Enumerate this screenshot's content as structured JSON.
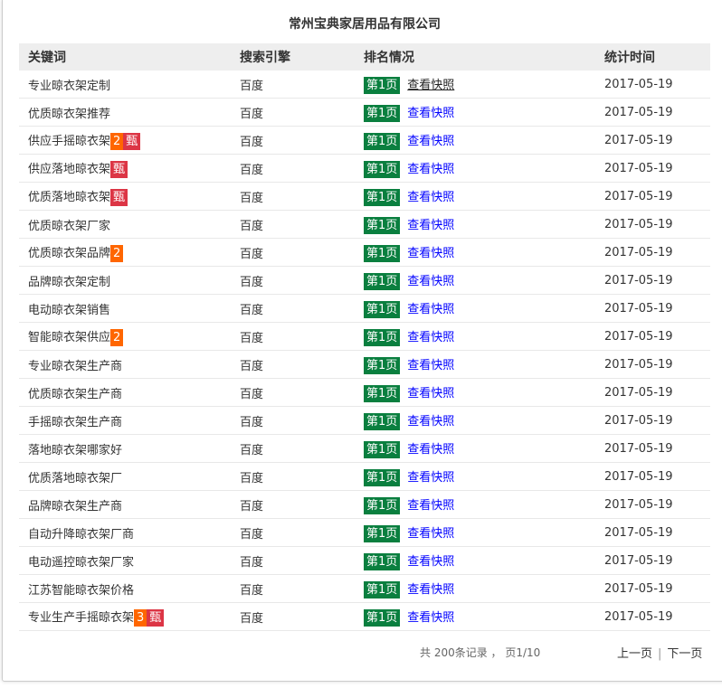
{
  "title": "常州宝典家居用品有限公司",
  "headers": [
    "关键词",
    "搜索引擎",
    "排名情况",
    "统计时间"
  ],
  "rows": [
    {
      "kw": "专业晾衣架定制",
      "badges": [],
      "engine": "百度",
      "rank": "第1页",
      "link": "查看快照",
      "date": "2017-05-19"
    },
    {
      "kw": "优质晾衣架推荐",
      "badges": [],
      "engine": "百度",
      "rank": "第1页",
      "link": "查看快照",
      "date": "2017-05-19"
    },
    {
      "kw": "供应手摇晾衣架",
      "badges": [
        {
          "t": "2",
          "c": "orange"
        },
        {
          "t": "甄",
          "c": "red"
        }
      ],
      "engine": "百度",
      "rank": "第1页",
      "link": "查看快照",
      "date": "2017-05-19"
    },
    {
      "kw": "供应落地晾衣架",
      "badges": [
        {
          "t": "甄",
          "c": "red"
        }
      ],
      "engine": "百度",
      "rank": "第1页",
      "link": "查看快照",
      "date": "2017-05-19"
    },
    {
      "kw": "优质落地晾衣架",
      "badges": [
        {
          "t": "甄",
          "c": "red"
        }
      ],
      "engine": "百度",
      "rank": "第1页",
      "link": "查看快照",
      "date": "2017-05-19"
    },
    {
      "kw": "优质晾衣架厂家",
      "badges": [],
      "engine": "百度",
      "rank": "第1页",
      "link": "查看快照",
      "date": "2017-05-19"
    },
    {
      "kw": "优质晾衣架品牌",
      "badges": [
        {
          "t": "2",
          "c": "orange"
        }
      ],
      "engine": "百度",
      "rank": "第1页",
      "link": "查看快照",
      "date": "2017-05-19"
    },
    {
      "kw": "品牌晾衣架定制",
      "badges": [],
      "engine": "百度",
      "rank": "第1页",
      "link": "查看快照",
      "date": "2017-05-19"
    },
    {
      "kw": "电动晾衣架销售",
      "badges": [],
      "engine": "百度",
      "rank": "第1页",
      "link": "查看快照",
      "date": "2017-05-19"
    },
    {
      "kw": "智能晾衣架供应",
      "badges": [
        {
          "t": "2",
          "c": "orange"
        }
      ],
      "engine": "百度",
      "rank": "第1页",
      "link": "查看快照",
      "date": "2017-05-19"
    },
    {
      "kw": "专业晾衣架生产商",
      "badges": [],
      "engine": "百度",
      "rank": "第1页",
      "link": "查看快照",
      "date": "2017-05-19"
    },
    {
      "kw": "优质晾衣架生产商",
      "badges": [],
      "engine": "百度",
      "rank": "第1页",
      "link": "查看快照",
      "date": "2017-05-19"
    },
    {
      "kw": "手摇晾衣架生产商",
      "badges": [],
      "engine": "百度",
      "rank": "第1页",
      "link": "查看快照",
      "date": "2017-05-19"
    },
    {
      "kw": "落地晾衣架哪家好",
      "badges": [],
      "engine": "百度",
      "rank": "第1页",
      "link": "查看快照",
      "date": "2017-05-19"
    },
    {
      "kw": "优质落地晾衣架厂",
      "badges": [],
      "engine": "百度",
      "rank": "第1页",
      "link": "查看快照",
      "date": "2017-05-19"
    },
    {
      "kw": "品牌晾衣架生产商",
      "badges": [],
      "engine": "百度",
      "rank": "第1页",
      "link": "查看快照",
      "date": "2017-05-19"
    },
    {
      "kw": "自动升降晾衣架厂商",
      "badges": [],
      "engine": "百度",
      "rank": "第1页",
      "link": "查看快照",
      "date": "2017-05-19"
    },
    {
      "kw": "电动遥控晾衣架厂家",
      "badges": [],
      "engine": "百度",
      "rank": "第1页",
      "link": "查看快照",
      "date": "2017-05-19"
    },
    {
      "kw": "江苏智能晾衣架价格",
      "badges": [],
      "engine": "百度",
      "rank": "第1页",
      "link": "查看快照",
      "date": "2017-05-19"
    },
    {
      "kw": "专业生产手摇晾衣架",
      "badges": [
        {
          "t": "3",
          "c": "orange"
        },
        {
          "t": "甄",
          "c": "red"
        }
      ],
      "engine": "百度",
      "rank": "第1页",
      "link": "查看快照",
      "date": "2017-05-19"
    }
  ],
  "footer": {
    "summary": "共  200条记录 ， 页1/10",
    "prev": "上一页",
    "sep": "|",
    "next": "下一页"
  },
  "colors": {
    "rank_badge": "#0a7f3f",
    "count_badge": "#ff6600",
    "zhen_badge": "#dc3545",
    "link": "#0000ff"
  }
}
